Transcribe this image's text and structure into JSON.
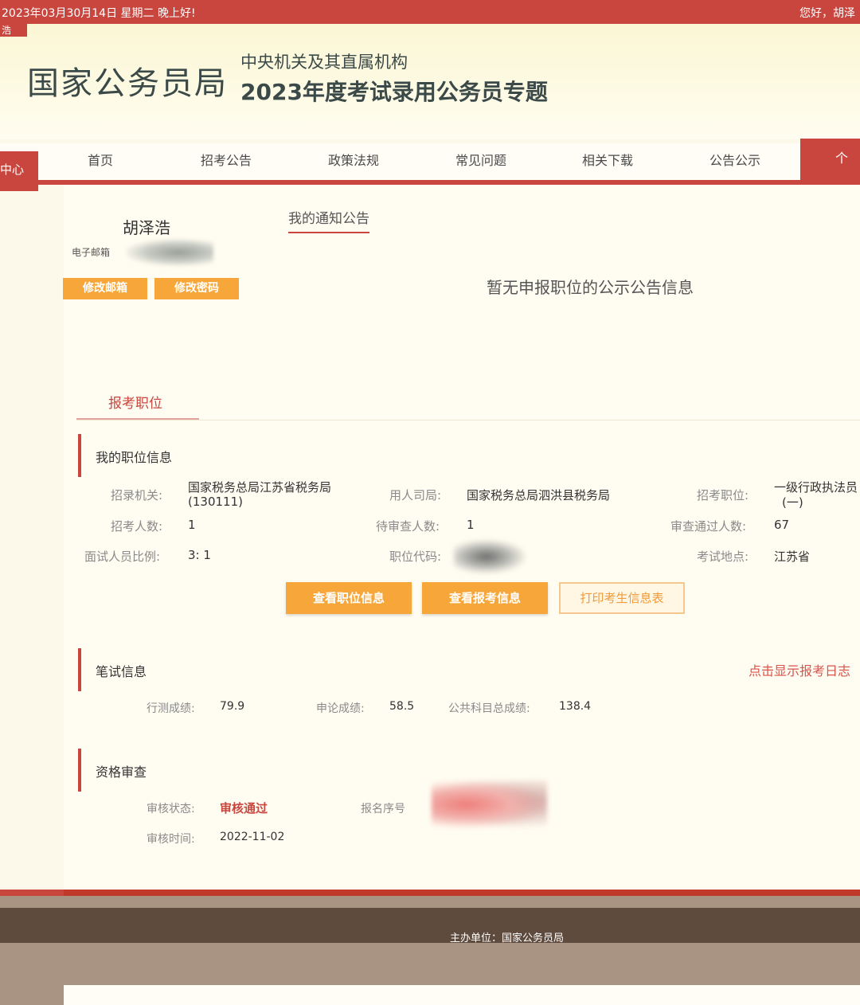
{
  "topbar": {
    "date": "2023年03月30月14日  星期二  晚上好!",
    "greeting": "您好，胡泽",
    "corner": "浩"
  },
  "header": {
    "logo": "国家公务员局",
    "subtitle1": "中央机关及其直属机构",
    "subtitle2": "2023年度考试录用公务员专题"
  },
  "nav": {
    "left_tab": "中心",
    "items": [
      "首页",
      "招考公告",
      "政策法规",
      "常见问题",
      "相关下载",
      "公告公示"
    ],
    "right_tab": "个人"
  },
  "user": {
    "name": "胡泽浩",
    "email_label": "电子邮箱",
    "edit_email": "修改邮箱",
    "edit_password": "修改密码"
  },
  "notices": {
    "tab": "我的通知公告",
    "empty": "暂无申报职位的公示公告信息"
  },
  "apply": {
    "tab": "报考职位"
  },
  "position": {
    "title": "我的职位信息",
    "agency_label": "招录机关:",
    "agency_value": "国家税务总局江苏省税务局",
    "agency_code": "(130111)",
    "employer_label": "用人司局:",
    "employer_value": "国家税务总局泗洪县税务局",
    "post_label": "招考职位:",
    "post_value": "一级行政执法员",
    "post_value2": "(一)",
    "count_label": "招考人数:",
    "count_value": "1",
    "pending_label": "待审查人数:",
    "pending_value": "1",
    "passed_label": "审查通过人数:",
    "passed_value": "67",
    "ratio_label": "面试人员比例:",
    "ratio_value": "3: 1",
    "code_label": "职位代码:",
    "place_label": "考试地点:",
    "place_value": "江苏省",
    "btn_view_position": "查看职位信息",
    "btn_view_apply": "查看报考信息",
    "btn_print": "打印考生信息表"
  },
  "written": {
    "title": "笔试信息",
    "log_link": "点击显示报考日志",
    "xc_label": "行测成绩:",
    "xc_value": "79.9",
    "sl_label": "申论成绩:",
    "sl_value": "58.5",
    "total_label": "公共科目总成绩:",
    "total_value": "138.4"
  },
  "review": {
    "title": "资格审查",
    "status_label": "审核状态:",
    "status_value": "审核通过",
    "serial_label": "报名序号",
    "time_label": "审核时间:",
    "time_value": "2022-11-02"
  },
  "footer": {
    "text": "主办单位：国家公务员局"
  }
}
